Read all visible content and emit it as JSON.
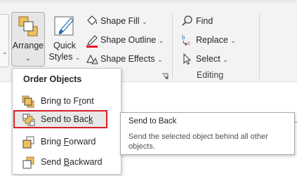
{
  "ribbon": {
    "drawing_group": {
      "arrange_label": "Arrange",
      "quick_styles_line1": "Quick",
      "quick_styles_line2": "Styles",
      "shape_fill": "Shape Fill",
      "shape_outline": "Shape Outline",
      "shape_effects": "Shape Effects",
      "outline_color": "#e81123"
    },
    "editing_group": {
      "find": "Find",
      "replace": "Replace",
      "select": "Select",
      "label": "Editing"
    }
  },
  "arrange_menu": {
    "header": "Order Objects",
    "items": [
      {
        "label_pre": "Bring to F",
        "label_key": "r",
        "label_post": "ont",
        "icon": "bring-to-front-icon"
      },
      {
        "label_pre": "Send to Bac",
        "label_key": "k",
        "label_post": "",
        "icon": "send-to-back-icon",
        "highlighted": true
      },
      {
        "label_pre": "Bring ",
        "label_key": "F",
        "label_post": "orward",
        "icon": "bring-forward-icon"
      },
      {
        "label_pre": "Send ",
        "label_key": "B",
        "label_post": "ackward",
        "icon": "send-backward-icon"
      }
    ]
  },
  "tooltip": {
    "title": "Send to Back",
    "description": "Send the selected object behind all other objects."
  },
  "colors": {
    "highlight_border": "#d71f26",
    "shape_orange": "#f0c060",
    "accent_blue": "#2b6cb0"
  }
}
